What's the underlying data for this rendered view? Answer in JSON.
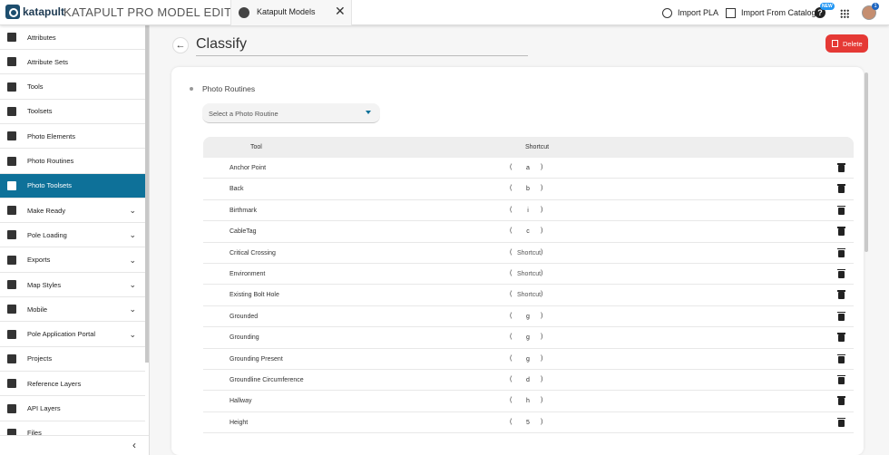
{
  "header": {
    "logo_text": "katapult",
    "app_title": "KATAPULT PRO MODEL EDITOR",
    "tab": {
      "label": "Katapult Models",
      "close": "✕"
    },
    "import_pla": "Import PLA",
    "import_catalog": "Import From Catalog",
    "help": "?",
    "new_badge": "NEW",
    "notification_count": "1"
  },
  "sidebar": {
    "items": [
      {
        "label": "Attributes",
        "icon": "list-icon"
      },
      {
        "label": "Attribute Sets",
        "icon": "table-icon"
      },
      {
        "label": "Tools",
        "icon": "tools-icon"
      },
      {
        "label": "Toolsets",
        "icon": "toolbox-icon"
      },
      {
        "label": "Photo Elements",
        "icon": "shapes-icon"
      },
      {
        "label": "Photo Routines",
        "icon": "add-box-icon"
      },
      {
        "label": "Photo Toolsets",
        "icon": "photo-library-icon",
        "active": true
      },
      {
        "label": "Make Ready",
        "icon": "checklist-icon",
        "expandable": true
      },
      {
        "label": "Pole Loading",
        "icon": "360-icon",
        "expandable": true
      },
      {
        "label": "Exports",
        "icon": "export-icon",
        "expandable": true
      },
      {
        "label": "Map Styles",
        "icon": "palette-icon",
        "expandable": true
      },
      {
        "label": "Mobile",
        "icon": "phone-icon",
        "expandable": true
      },
      {
        "label": "Pole Application Portal",
        "icon": "portal-icon",
        "expandable": true
      },
      {
        "label": "Projects",
        "icon": "clipboard-icon"
      },
      {
        "label": "Reference Layers",
        "icon": "pin-icon"
      },
      {
        "label": "API Layers",
        "icon": "layers-icon"
      },
      {
        "label": "Files",
        "icon": "file-icon"
      }
    ],
    "chevron": "⌄",
    "collapse": "‹"
  },
  "page": {
    "back": "←",
    "title": "Classify",
    "delete_label": "Delete"
  },
  "card": {
    "section_label": "Photo Routines",
    "select_placeholder": "Select a Photo Routine",
    "table": {
      "headers": {
        "tool": "Tool",
        "shortcut": "Shortcut"
      },
      "rows": [
        {
          "tool": "Anchor Point",
          "shortcut": "a"
        },
        {
          "tool": "Back",
          "shortcut": "b"
        },
        {
          "tool": "Birthmark",
          "shortcut": "i"
        },
        {
          "tool": "CableTag",
          "shortcut": "c"
        },
        {
          "tool": "Critical Crossing",
          "shortcut": "Shortcut",
          "placeholder": true
        },
        {
          "tool": "Environment",
          "shortcut": "Shortcut",
          "placeholder": true
        },
        {
          "tool": "Existing Bolt Hole",
          "shortcut": "Shortcut",
          "placeholder": true
        },
        {
          "tool": "Grounded",
          "shortcut": "g"
        },
        {
          "tool": "Grounding",
          "shortcut": "g"
        },
        {
          "tool": "Grounding Present",
          "shortcut": "g"
        },
        {
          "tool": "Groundline Circumference",
          "shortcut": "d"
        },
        {
          "tool": "Hallway",
          "shortcut": "h"
        },
        {
          "tool": "Height",
          "shortcut": "5"
        }
      ]
    }
  },
  "colors": {
    "accent": "#0e7199",
    "delete": "#e53935",
    "badge": "#2196f3"
  }
}
